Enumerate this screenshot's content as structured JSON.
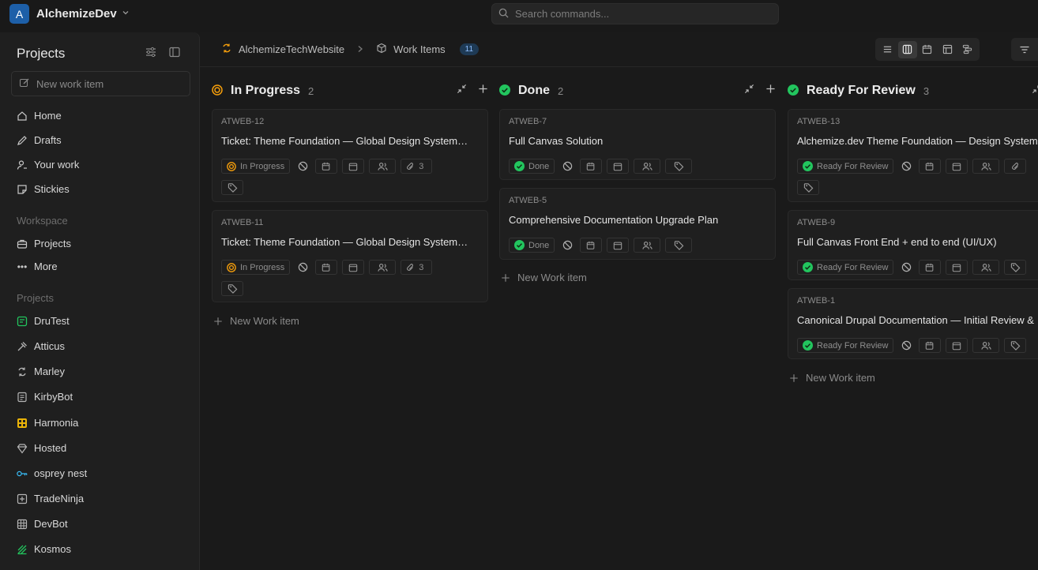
{
  "workspace": {
    "initial": "A",
    "name": "AlchemizeDev"
  },
  "search": {
    "placeholder": "Search commands..."
  },
  "sidebar": {
    "title": "Projects",
    "new_work_item": "New work item",
    "nav": [
      {
        "label": "Home",
        "icon": "home-icon"
      },
      {
        "label": "Drafts",
        "icon": "pencil-icon"
      },
      {
        "label": "Your work",
        "icon": "user-icon"
      },
      {
        "label": "Stickies",
        "icon": "sticky-note-icon"
      }
    ],
    "workspace_label": "Workspace",
    "workspace_items": [
      {
        "label": "Projects",
        "icon": "briefcase-icon"
      },
      {
        "label": "More",
        "icon": "more-icon"
      }
    ],
    "projects_label": "Projects",
    "projects": [
      {
        "label": "DruTest",
        "color": "#22c55e"
      },
      {
        "label": "Atticus",
        "color": "#a3a3a3"
      },
      {
        "label": "Marley",
        "color": "#a3a3a3"
      },
      {
        "label": "KirbyBot",
        "color": "#a3a3a3"
      },
      {
        "label": "Harmonia",
        "color": "#eab308"
      },
      {
        "label": "Hosted",
        "color": "#a3a3a3"
      },
      {
        "label": "osprey nest",
        "color": "#38bdf8"
      },
      {
        "label": "TradeNinja",
        "color": "#a3a3a3"
      },
      {
        "label": "DevBot",
        "color": "#a3a3a3"
      },
      {
        "label": "Kosmos",
        "color": "#22c55e"
      }
    ]
  },
  "header": {
    "project": "AlchemizeTechWebsite",
    "section": "Work Items",
    "count": "11"
  },
  "columns": [
    {
      "title": "In Progress",
      "count": "2",
      "status_color": "#f59e0b",
      "new_label": "New Work item",
      "cards": [
        {
          "id": "ATWEB-12",
          "title": "Ticket: Theme Foundation — Global Design System…",
          "state": "In Progress",
          "attachments": "3"
        },
        {
          "id": "ATWEB-11",
          "title": "Ticket: Theme Foundation — Global Design System…",
          "state": "In Progress",
          "attachments": "3"
        }
      ]
    },
    {
      "title": "Done",
      "count": "2",
      "status_color": "#22c55e",
      "new_label": "New Work item",
      "cards": [
        {
          "id": "ATWEB-7",
          "title": "Full Canvas Solution",
          "state": "Done"
        },
        {
          "id": "ATWEB-5",
          "title": "Comprehensive Documentation Upgrade Plan",
          "state": "Done"
        }
      ]
    },
    {
      "title": "Ready For Review",
      "count": "3",
      "status_color": "#22c55e",
      "new_label": "New Work item",
      "cards": [
        {
          "id": "ATWEB-13",
          "title": "Alchemize.dev Theme Foundation — Design System",
          "state": "Ready For Review"
        },
        {
          "id": "ATWEB-9",
          "title": "Full Canvas Front End + end to end (UI/UX)",
          "state": "Ready For Review"
        },
        {
          "id": "ATWEB-1",
          "title": "Canonical Drupal Documentation — Initial Review &",
          "state": "Ready For Review"
        }
      ]
    }
  ]
}
